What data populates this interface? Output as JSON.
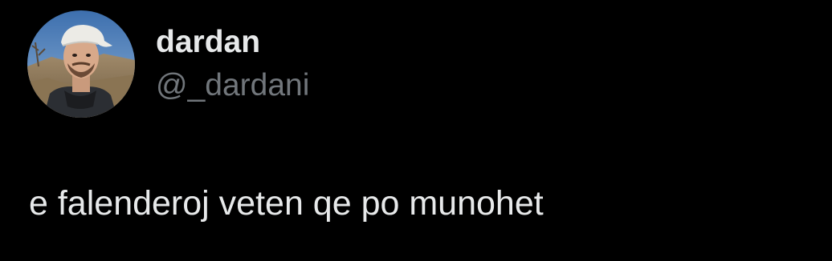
{
  "tweet": {
    "author": {
      "display_name": "dardan",
      "handle": "@_dardani",
      "avatar": "profile-photo-man-white-cap"
    },
    "text": "e falenderoj veten qe po munohet"
  },
  "colors": {
    "background": "#000000",
    "primary_text": "#e7e9ea",
    "secondary_text": "#71767b"
  }
}
